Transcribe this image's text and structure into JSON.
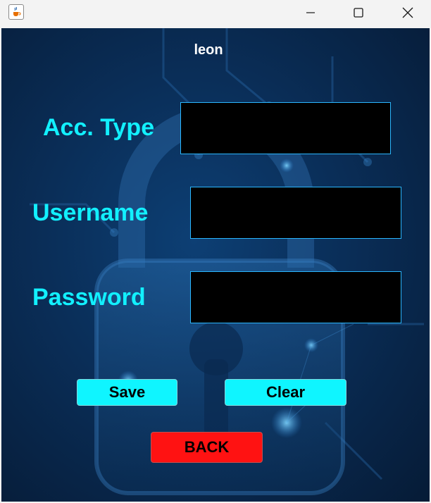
{
  "window": {
    "icon": "java-coffee-icon",
    "controls": [
      "minimize-icon",
      "maximize-icon",
      "close-icon"
    ]
  },
  "header": {
    "user": "leon"
  },
  "form": {
    "acc_type_label": "Acc. Type",
    "acc_type_value": "",
    "username_label": "Username",
    "username_value": "",
    "password_label": "Password",
    "password_value": ""
  },
  "buttons": {
    "save": "Save",
    "clear": "Clear",
    "back": "BACK"
  },
  "colors": {
    "label_cyan": "#12f0ff",
    "button_cyan": "#0ff5ff",
    "back_red": "#ff1212",
    "field_bg": "#000000",
    "background_blue": "#0a2e58"
  }
}
